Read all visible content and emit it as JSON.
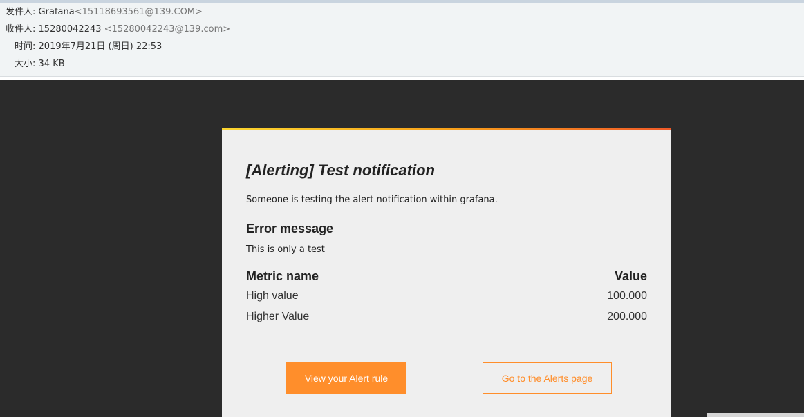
{
  "email_header": {
    "from_label": "发件人:",
    "from_name": "Grafana",
    "from_address": "<15118693561@139.COM>",
    "to_label": "收件人:",
    "to_name": "15280042243",
    "to_address": "<15280042243@139.com>",
    "time_label": "时间:",
    "time_value": "2019年7月21日 (周日) 22:53",
    "size_label": "大小:",
    "size_value": "34 KB"
  },
  "notification": {
    "title": "[Alerting] Test notification",
    "intro": "Someone is testing the alert notification within grafana.",
    "error_heading": "Error message",
    "error_message": "This is only a test",
    "metrics_header": {
      "name": "Metric name",
      "value": "Value"
    },
    "metrics": [
      {
        "name": "High value",
        "value": "100.000"
      },
      {
        "name": "Higher Value",
        "value": "200.000"
      }
    ],
    "buttons": {
      "view_rule": "View your Alert rule",
      "alerts_page": "Go to the Alerts page"
    }
  },
  "colors": {
    "accent": "#ff8e2b",
    "background_dark": "#2b2b2b",
    "card_background": "#efefef"
  }
}
